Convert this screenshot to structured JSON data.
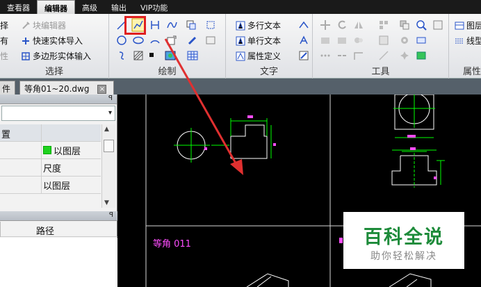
{
  "menubar": {
    "items": [
      "查看器",
      "编辑器",
      "高级",
      "输出",
      "VIP功能"
    ],
    "active": "编辑器"
  },
  "ribbon": {
    "edit_group": {
      "label": "选择",
      "items": [
        "择",
        "块编辑器",
        "有",
        "快速实体导入",
        "性",
        "多边形实体输入"
      ]
    },
    "draw_group": {
      "label": "绘制"
    },
    "text_group": {
      "label": "文字",
      "items": [
        "多行文本",
        "单行文本",
        "属性定义"
      ]
    },
    "tools_group": {
      "label": "工具"
    },
    "props_group": {
      "label": "属性",
      "items": [
        "图层",
        "线型"
      ]
    }
  },
  "doctabs": {
    "partial_tab": "件",
    "active_tab": "等角01~20.dwg",
    "close_symbol": "×"
  },
  "leftpanel": {
    "pin": "ꟼ",
    "combo_arrow": "▾",
    "prop_rows": [
      {
        "name": "置",
        "value": ""
      },
      {
        "name": "",
        "value": "以图层"
      },
      {
        "name": "",
        "value": "尺度"
      },
      {
        "name": "",
        "value": "以图层"
      }
    ],
    "path_column": "路径"
  },
  "drawing": {
    "label_left": "等角 011"
  },
  "watermark": {
    "title": "百科全说",
    "subtitle": "助你轻松解决"
  },
  "colors": {
    "highlight": "#e02020",
    "dimension": "#00ff00",
    "label": "#ff4dff",
    "geometry": "#ffffff"
  }
}
